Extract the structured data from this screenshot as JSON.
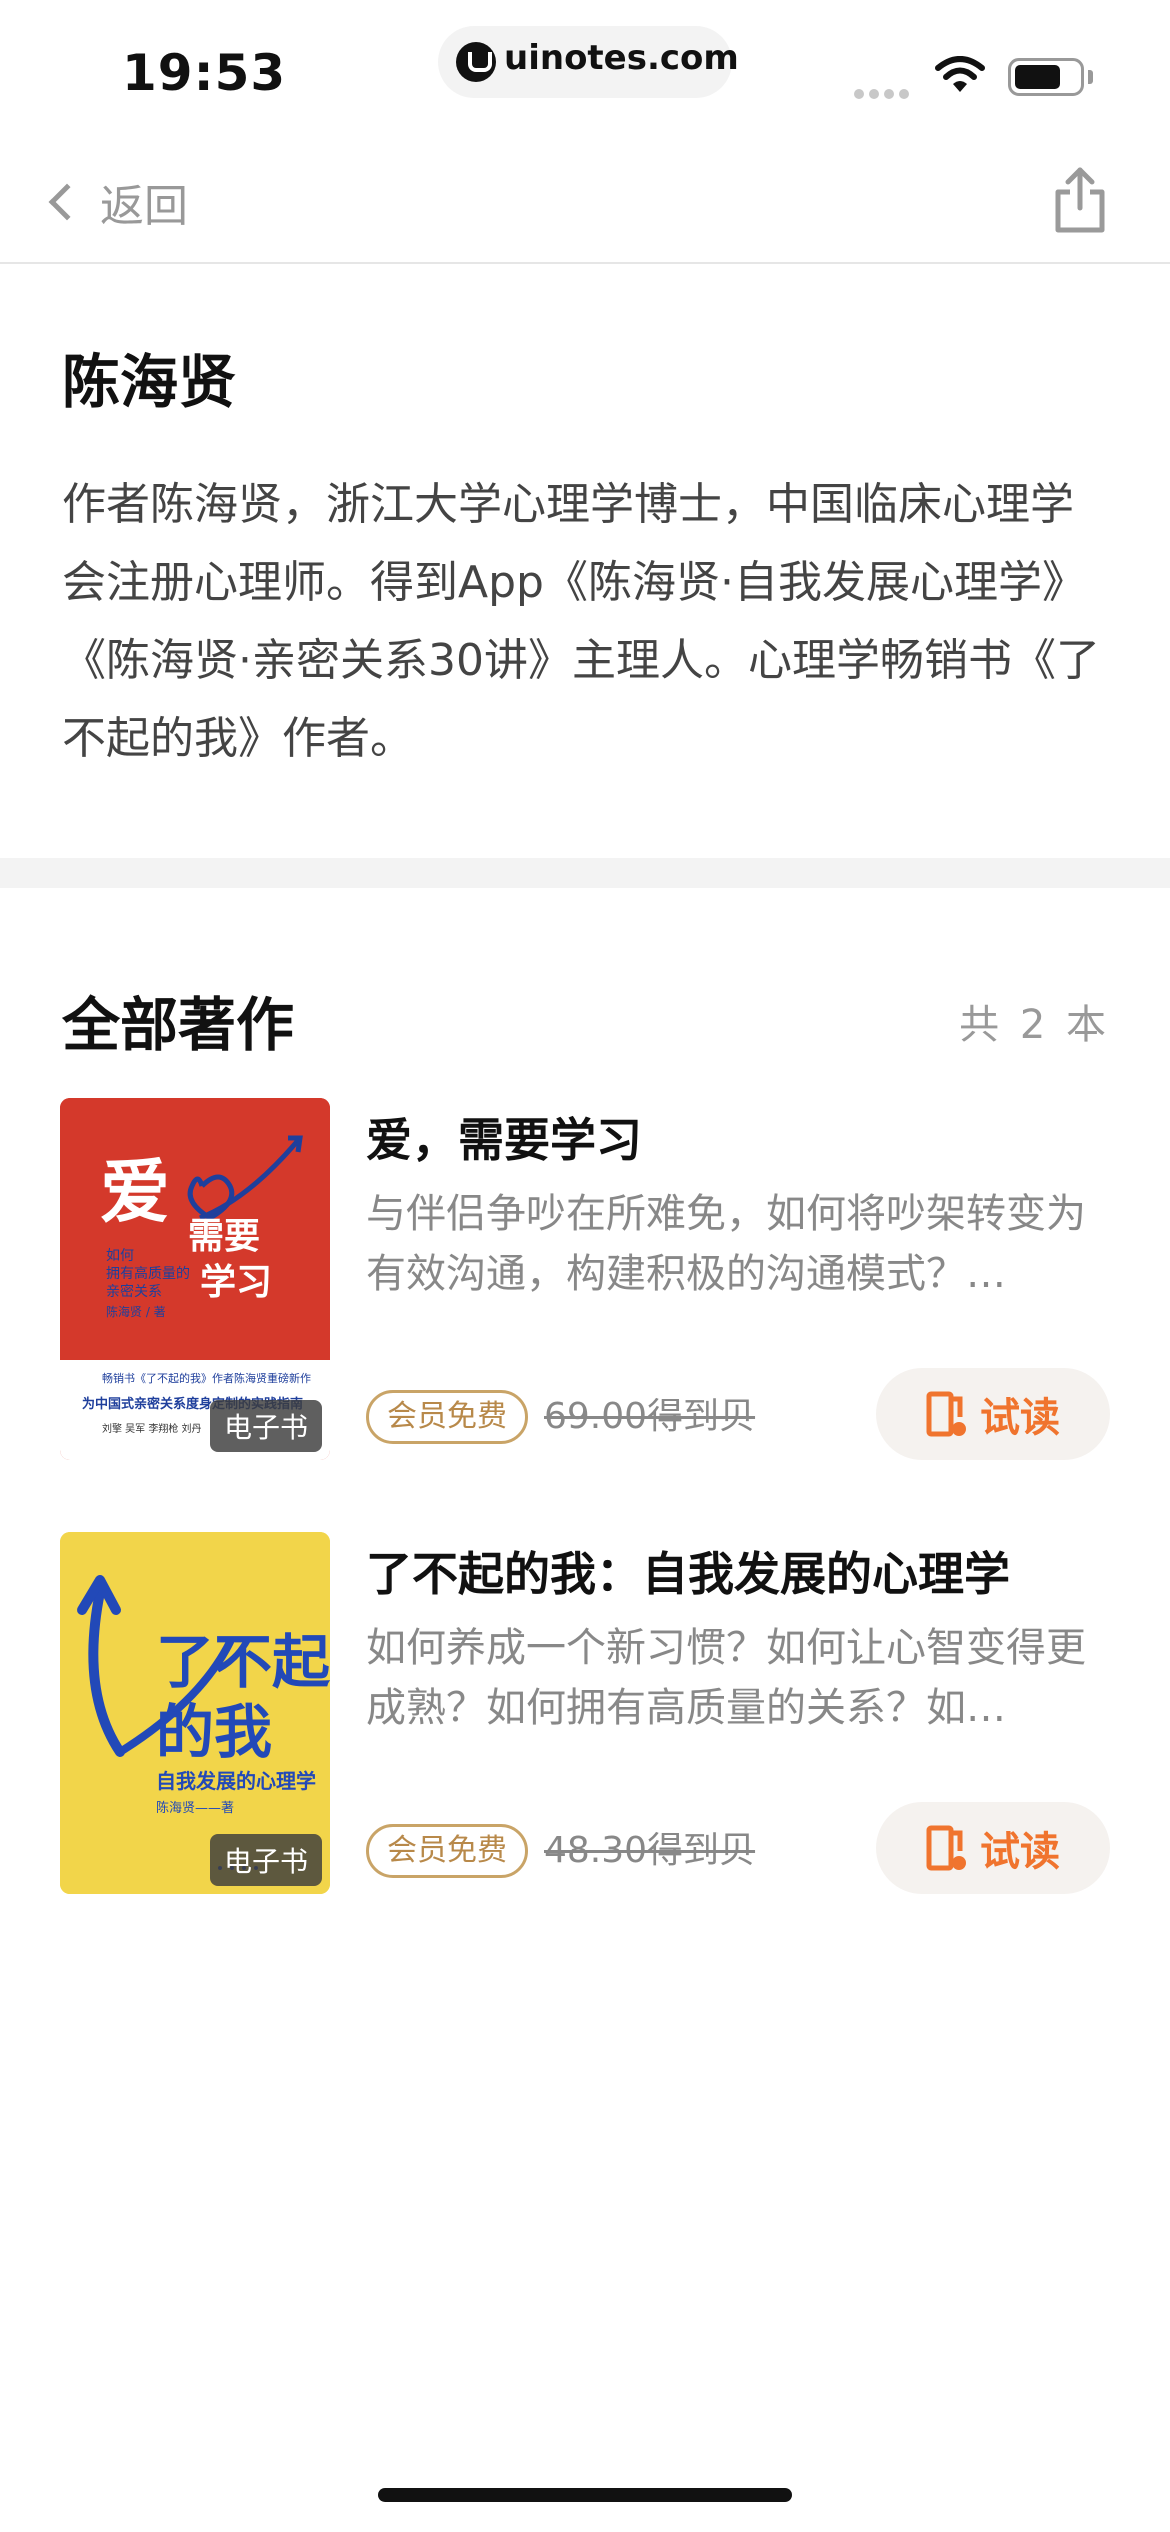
{
  "status_bar": {
    "time": "19:53",
    "url": "uinotes.com"
  },
  "nav": {
    "back_label": "返回"
  },
  "author": {
    "name": "陈海贤",
    "bio": "作者陈海贤，浙江大学心理学博士，中国临床心理学会注册心理师。得到App《陈海贤·自我发展心理学》《陈海贤·亲密关系30讲》主理人。心理学畅销书《了不起的我》作者。"
  },
  "works": {
    "title": "全部著作",
    "count_label": "共 2 本",
    "books": [
      {
        "title": "爱，需要学习",
        "description": "与伴侣争吵在所难免，如何将吵架转变为有效沟通，构建积极的沟通模式？…",
        "ebook_tag": "电子书",
        "member_badge": "会员免费",
        "price": "69.00得到贝",
        "trial_label": "试读",
        "cover": {
          "main": "爱",
          "sub": "需要学习",
          "lines": [
            "如何",
            "拥有高质量的",
            "亲密关系"
          ],
          "author": "陈海贤 / 著",
          "tagline": "畅销书《了不起的我》作者陈海贤重磅新作",
          "subtitle": "为中国式亲密关系度身定制的实践指南",
          "names": "刘擎  吴军  李翔枪  刘丹"
        }
      },
      {
        "title": "了不起的我：自我发展的心理学",
        "description": "如何养成一个新习惯？如何让心智变得更成熟？如何拥有高质量的关系？如…",
        "ebook_tag": "电子书",
        "member_badge": "会员免费",
        "price": "48.30得到贝",
        "trial_label": "试读",
        "cover": {
          "main": "了不起",
          "main2": "的我",
          "sub": "自我发展的心理学",
          "author": "陈海贤——著"
        }
      }
    ]
  },
  "colors": {
    "accent": "#f0742e",
    "gold": "#c9a467",
    "cover1_bg": "#d4392b",
    "cover2_bg": "#f2d54a",
    "cover2_blue": "#2249b8"
  },
  "icons": [
    "wifi-icon",
    "battery-icon",
    "chevron-left-icon",
    "share-icon",
    "trial-read-icon"
  ]
}
